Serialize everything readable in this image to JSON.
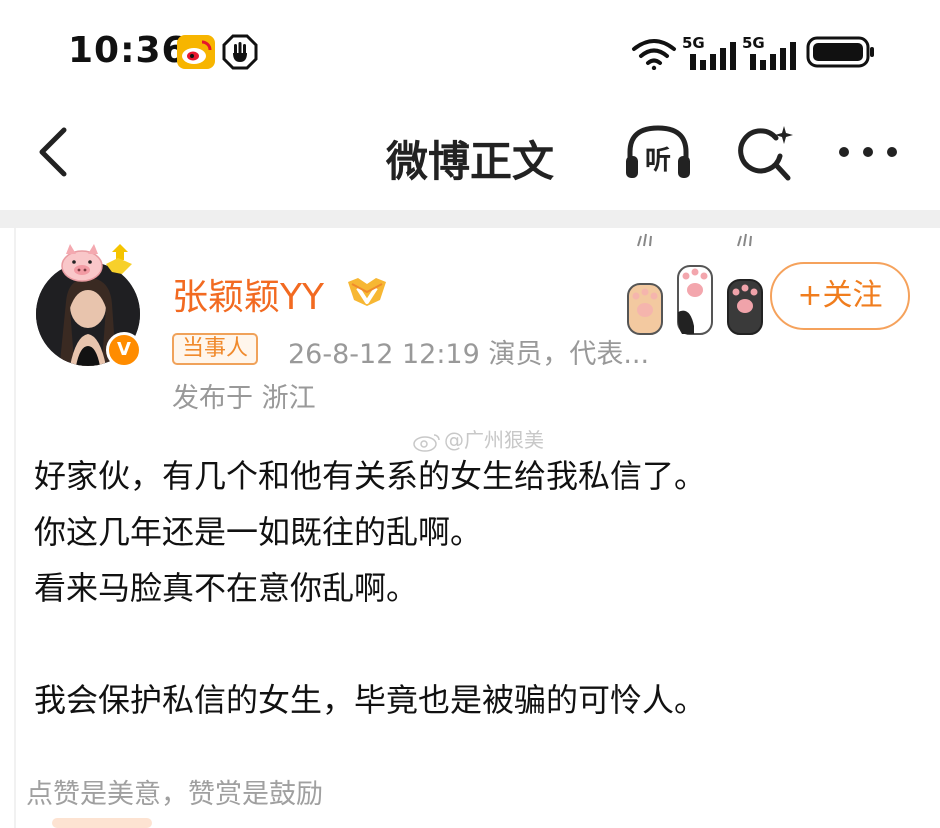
{
  "status_bar": {
    "time": "10:36",
    "signal1_label": "5G",
    "signal2_label": "5G"
  },
  "nav": {
    "title": "微博正文",
    "listen_label": "听"
  },
  "post": {
    "author_name": "张颖颖YY",
    "role_badge": "当事人",
    "meta": "26-8-12 12:19  演员，代表...",
    "location": "发布于 浙江",
    "follow_label": "+关注",
    "verified_mark": "V",
    "watermark": "@广州狠美",
    "body_lines": [
      "好家伙，有几个和他有关系的女生给我私信了。",
      "你这几年还是一如既往的乱啊。",
      "看来马脸真不在意你乱啊。",
      "",
      "我会保护私信的女生，毕竟也是被骗的可怜人。"
    ],
    "reward_text": "点赞是美意，赞赏是鼓励"
  },
  "colors": {
    "accent_orange": "#f26a21",
    "follow_border": "#f5a25c",
    "meta_gray": "#999999"
  },
  "icons": [
    "weibo-app-icon",
    "hand-stop-icon",
    "wifi-icon",
    "signal-bars-icon",
    "battery-icon",
    "back-arrow-icon",
    "listen-headphone-icon",
    "search-sparkle-icon",
    "more-dots-icon",
    "vip-icon",
    "verified-icon",
    "cat-paws-sticker",
    "pig-pendant-sticker",
    "weibo-watermark-icon"
  ]
}
